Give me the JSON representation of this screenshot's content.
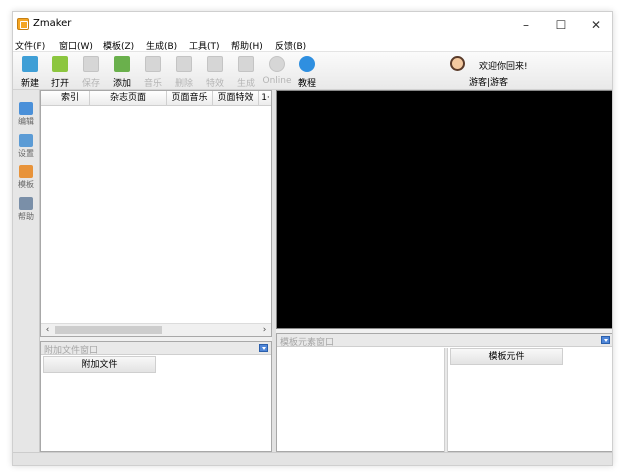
{
  "window": {
    "title": "Zmaker"
  },
  "window_controls": {
    "minimize": "–",
    "maximize": "☐",
    "close": "✕"
  },
  "menu": [
    {
      "label": "文件(F)"
    },
    {
      "label": "窗口(W)"
    },
    {
      "label": "模板(Z)"
    },
    {
      "label": "生成(B)"
    },
    {
      "label": "工具(T)"
    },
    {
      "label": "帮助(H)"
    },
    {
      "label": "反馈(B)"
    }
  ],
  "toolbar": [
    {
      "label": "新建",
      "icon": "new-file-icon",
      "enabled": true,
      "color": "#3f9fd6"
    },
    {
      "label": "打开",
      "icon": "open-folder-icon",
      "enabled": true,
      "color": "#8cc63f"
    },
    {
      "label": "保存",
      "icon": "save-icon",
      "enabled": false,
      "color": "#cccccc"
    },
    {
      "label": "添加",
      "icon": "add-page-icon",
      "enabled": true,
      "color": "#6ab04c"
    },
    {
      "label": "音乐",
      "icon": "music-icon",
      "enabled": false,
      "color": "#cccccc"
    },
    {
      "label": "删除",
      "icon": "delete-icon",
      "enabled": false,
      "color": "#cccccc"
    },
    {
      "label": "特效",
      "icon": "effects-icon",
      "enabled": false,
      "color": "#cccccc"
    },
    {
      "label": "生成",
      "icon": "build-icon",
      "enabled": false,
      "color": "#cccccc"
    },
    {
      "label": "Online",
      "icon": "online-icon",
      "enabled": false,
      "color": "#cccccc"
    },
    {
      "label": "教程",
      "icon": "help-icon",
      "enabled": true,
      "color": "#2f8fe0"
    }
  ],
  "user": {
    "welcome": "欢迎你回来!",
    "account": "游客|游客"
  },
  "sidebar": [
    {
      "label": "编辑",
      "icon": "edit-icon",
      "color": "#4a90d9"
    },
    {
      "label": "设置",
      "icon": "settings-icon",
      "color": "#5b9bd5"
    },
    {
      "label": "模板",
      "icon": "template-icon",
      "color": "#e8933a"
    },
    {
      "label": "帮助",
      "icon": "help-doc-icon",
      "color": "#7a8fa8"
    }
  ],
  "page_list": {
    "columns": [
      "索引",
      "杂志页面",
      "页面音乐",
      "页面特效",
      "1·"
    ]
  },
  "attach_panel": {
    "title": "附加文件窗口",
    "column": "附加文件"
  },
  "template_panel": {
    "title": "模板元素窗口",
    "column": "模板元件"
  },
  "colors": {
    "preview_bg": "#000000",
    "accent": "#4f86d8"
  }
}
